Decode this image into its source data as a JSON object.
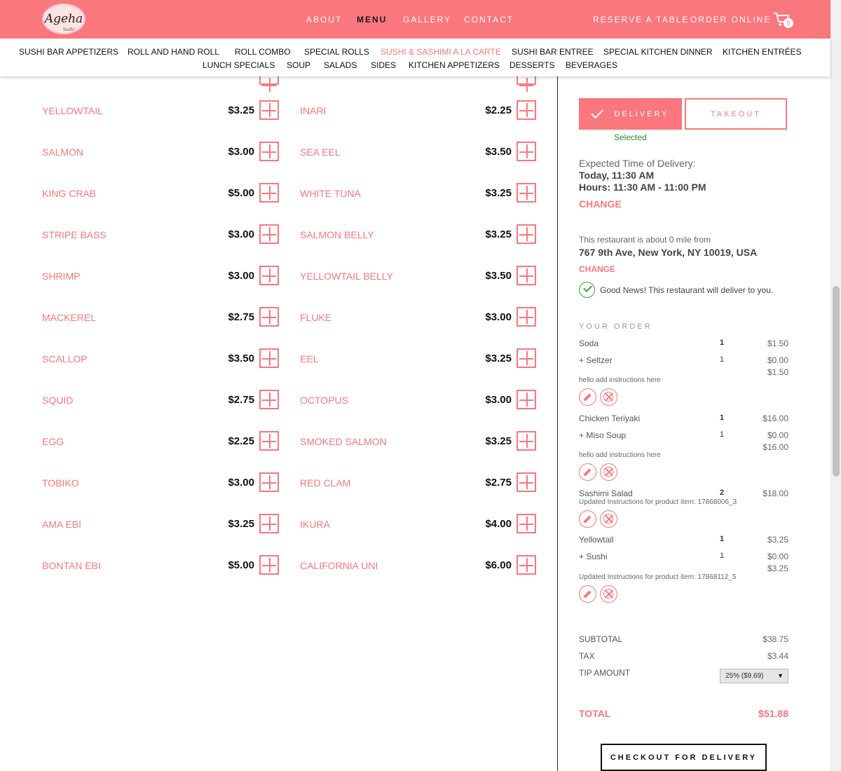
{
  "brand": {
    "logo_text": "Ageha",
    "logo_sub": "Sushi"
  },
  "nav": {
    "about": "ABOUT",
    "menu": "MENU",
    "gallery": "GALLERY",
    "contact": "CONTACT",
    "reserve": "RESERVE A TABLE",
    "order_online": "ORDER ONLINE",
    "cart_count": "5"
  },
  "categories": [
    "SUSHI BAR APPETIZERS",
    "ROLL AND HAND ROLL",
    "ROLL COMBO",
    "SPECIAL ROLLS",
    "SUSHI & SASHIMI A LA CARTE",
    "SUSHI BAR ENTREE",
    "SPECIAL KITCHEN DINNER",
    "KITCHEN ENTRÉES",
    "LUNCH SPECIALS",
    "SOUP",
    "SALADS",
    "SIDES",
    "KITCHEN APPETIZERS",
    "DESSERTS",
    "BEVERAGES"
  ],
  "active_category": "SUSHI & SASHIMI A LA CARTE",
  "menu_left": [
    {
      "name": "YELLOWTAIL",
      "price": "$3.25"
    },
    {
      "name": "SALMON",
      "price": "$3.00"
    },
    {
      "name": "KING CRAB",
      "price": "$5.00"
    },
    {
      "name": "STRIPE BASS",
      "price": "$3.00"
    },
    {
      "name": "SHRIMP",
      "price": "$3.00"
    },
    {
      "name": "MACKEREL",
      "price": "$2.75"
    },
    {
      "name": "SCALLOP",
      "price": "$3.50"
    },
    {
      "name": "SQUID",
      "price": "$2.75"
    },
    {
      "name": "EGG",
      "price": "$2.25"
    },
    {
      "name": "TOBIKO",
      "price": "$3.00"
    },
    {
      "name": "AMA EBI",
      "price": "$3.25"
    },
    {
      "name": "BONTAN EBI",
      "price": "$5.00"
    }
  ],
  "menu_right": [
    {
      "name": "INARI",
      "price": "$2.25"
    },
    {
      "name": "SEA EEL",
      "price": "$3.50"
    },
    {
      "name": "WHITE TUNA",
      "price": "$3.25"
    },
    {
      "name": "SALMON BELLY",
      "price": "$3.25"
    },
    {
      "name": "YELLOWTAIL BELLY",
      "price": "$3.50"
    },
    {
      "name": "FLUKE",
      "price": "$3.00"
    },
    {
      "name": "EEL",
      "price": "$3.25"
    },
    {
      "name": "OCTOPUS",
      "price": "$3.00"
    },
    {
      "name": "SMOKED SALMON",
      "price": "$3.25"
    },
    {
      "name": "RED CLAM",
      "price": "$2.75"
    },
    {
      "name": "IKURA",
      "price": "$4.00"
    },
    {
      "name": "CALIFORNIA UNI",
      "price": "$6.00"
    }
  ],
  "order_mode": {
    "delivery": "DELIVERY",
    "takeout": "TAKEOUT",
    "selected": "Selected"
  },
  "delivery_time": {
    "label": "Expected Time of Delivery:",
    "when": "Today, 11:30 AM",
    "hours": "Hours: 11:30 AM - 11:00 PM",
    "change": "CHANGE"
  },
  "address": {
    "distance": "This restaurant is about 0 mile from",
    "line": "767 9th Ave, New York, NY 10019, USA",
    "change": "CHANGE",
    "good_news": "Good News! This restaurant will deliver to you."
  },
  "order": {
    "heading": "YOUR ORDER",
    "items": [
      {
        "name": "Soda",
        "qty": "1",
        "price": "$1.50",
        "mod": "+ Seltzer",
        "mod_qty": "1",
        "mod_price": "$0.00",
        "line_total": "$1.50",
        "note": "hello add instructions here"
      },
      {
        "name": "Chicken Teriyaki",
        "qty": "1",
        "price": "$16.00",
        "mod": "+ Miso Soup",
        "mod_qty": "1",
        "mod_price": "$0.00",
        "line_total": "$16.00",
        "note": "hello add instructions here"
      },
      {
        "name": "Sashimi Salad",
        "qty": "2",
        "price": "$18.00",
        "note": "Updated Instructions for product item: 17868006_3"
      },
      {
        "name": "Yellowtail",
        "qty": "1",
        "price": "$3.25",
        "mod": "+ Sushi",
        "mod_qty": "1",
        "mod_price": "$0.00",
        "line_total": "$3.25",
        "note": "Updated Instructions for product item: 17868112_5"
      }
    ]
  },
  "summary": {
    "subtotal_label": "SUBTOTAL",
    "subtotal": "$38.75",
    "tax_label": "TAX",
    "tax": "$3.44",
    "tip_label": "TIP AMOUNT",
    "tip_selected": "25% ($9.69)",
    "total_label": "TOTAL",
    "total": "$51.88"
  },
  "checkout": "CHECKOUT FOR DELIVERY",
  "colors": {
    "accent": "#f9777d",
    "success": "#2e8b2e"
  }
}
